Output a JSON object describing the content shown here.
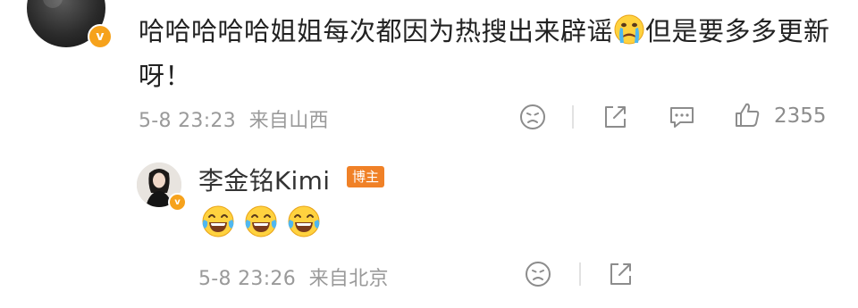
{
  "parent_comment": {
    "avatar": "user-avatar",
    "verified_badge": "v",
    "text_part1": "哈哈哈哈哈姐姐每次都因为热搜出来辟谣",
    "emoji": "crying-face-emoji",
    "text_part2": "但是要多多更新呀！",
    "time": "5-8 23:23",
    "location": "来自山西",
    "like_count": "2355"
  },
  "reply": {
    "avatar": "kimi-avatar",
    "verified_badge": "v",
    "name": "李金铭Kimi",
    "role_badge": "博主",
    "emojis": [
      "laughing-crying-emoji",
      "laughing-crying-emoji",
      "laughing-crying-emoji"
    ],
    "time": "5-8 23:26",
    "location": "来自北京"
  },
  "colors": {
    "meta_text": "#9a9a9a",
    "badge_orange": "#f08127",
    "verified_yellow": "#f6a21c"
  }
}
